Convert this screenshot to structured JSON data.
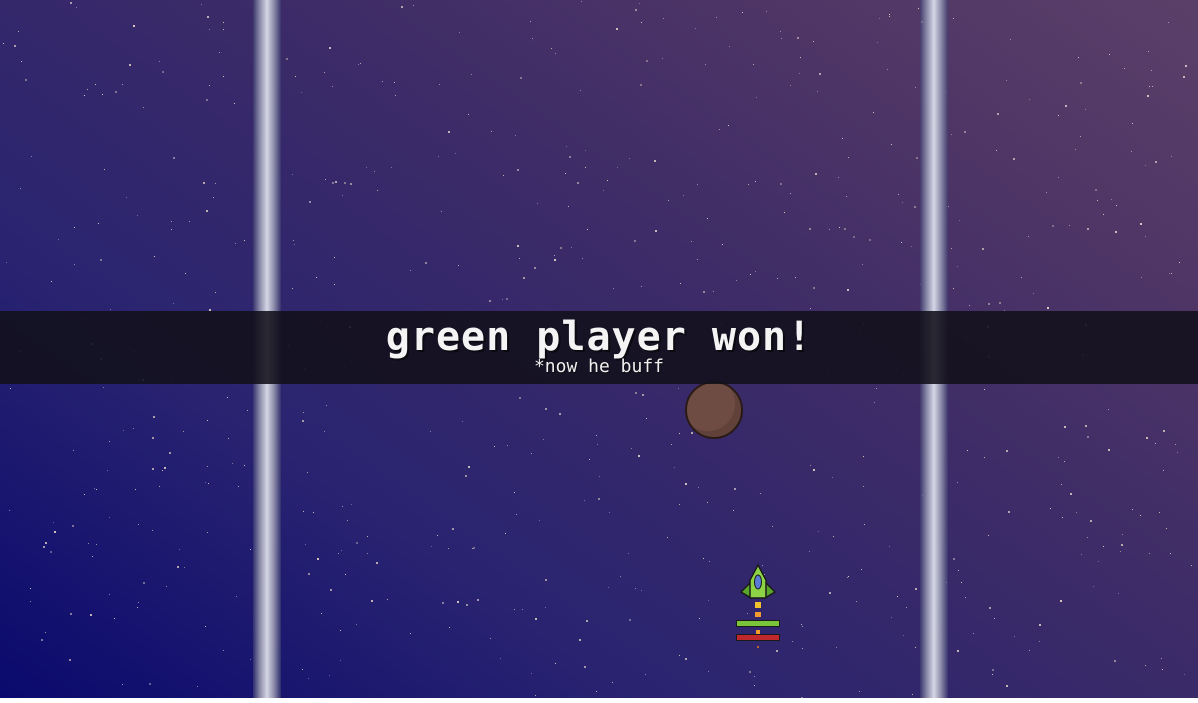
{
  "game": {
    "banner": {
      "title": "green player won!",
      "subtitle": "*now he buff"
    },
    "player": {
      "color": "#7ac43c",
      "health_fraction": 1.0,
      "energy_fraction": 1.0
    },
    "colors": {
      "background_top_right": "#5a4068",
      "background_bottom_left": "#0a0a6e",
      "asteroid": "#6e4c44",
      "health_bar": "#7ac43c",
      "energy_bar": "#c0282c",
      "banner_text": "#f4f4f4"
    }
  }
}
